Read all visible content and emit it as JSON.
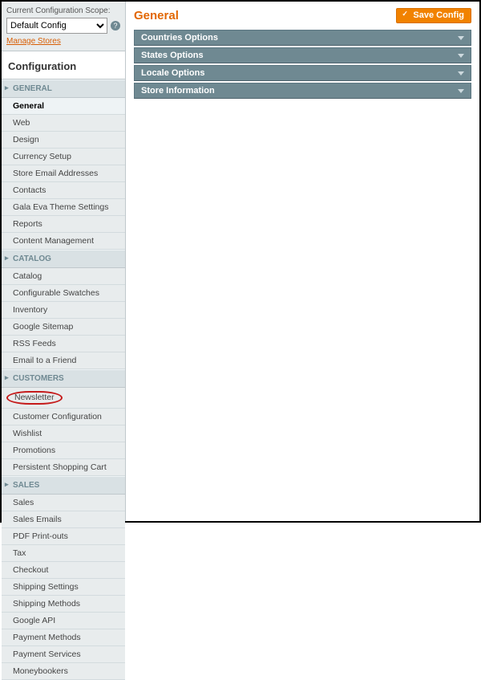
{
  "scope": {
    "label": "Current Configuration Scope:",
    "selected": "Default Config",
    "manage_link": "Manage Stores"
  },
  "configuration_heading": "Configuration",
  "groups": [
    {
      "title": "GENERAL",
      "items": [
        {
          "label": "General",
          "active": true
        },
        {
          "label": "Web"
        },
        {
          "label": "Design"
        },
        {
          "label": "Currency Setup"
        },
        {
          "label": "Store Email Addresses"
        },
        {
          "label": "Contacts"
        },
        {
          "label": "Gala Eva Theme Settings"
        },
        {
          "label": "Reports"
        },
        {
          "label": "Content Management"
        }
      ]
    },
    {
      "title": "CATALOG",
      "items": [
        {
          "label": "Catalog"
        },
        {
          "label": "Configurable Swatches"
        },
        {
          "label": "Inventory"
        },
        {
          "label": "Google Sitemap"
        },
        {
          "label": "RSS Feeds"
        },
        {
          "label": "Email to a Friend"
        }
      ]
    },
    {
      "title": "CUSTOMERS",
      "items": [
        {
          "label": "Newsletter",
          "circled": true
        },
        {
          "label": "Customer Configuration"
        },
        {
          "label": "Wishlist"
        },
        {
          "label": "Promotions"
        },
        {
          "label": "Persistent Shopping Cart"
        }
      ]
    },
    {
      "title": "SALES",
      "items": [
        {
          "label": "Sales"
        },
        {
          "label": "Sales Emails"
        },
        {
          "label": "PDF Print-outs"
        },
        {
          "label": "Tax"
        },
        {
          "label": "Checkout"
        },
        {
          "label": "Shipping Settings"
        },
        {
          "label": "Shipping Methods"
        },
        {
          "label": "Google API"
        },
        {
          "label": "Payment Methods"
        },
        {
          "label": "Payment Services"
        },
        {
          "label": "Moneybookers"
        }
      ]
    }
  ],
  "page": {
    "title": "General",
    "save_label": "Save Config"
  },
  "sections": [
    {
      "label": "Countries Options"
    },
    {
      "label": "States Options"
    },
    {
      "label": "Locale Options"
    },
    {
      "label": "Store Information"
    }
  ]
}
